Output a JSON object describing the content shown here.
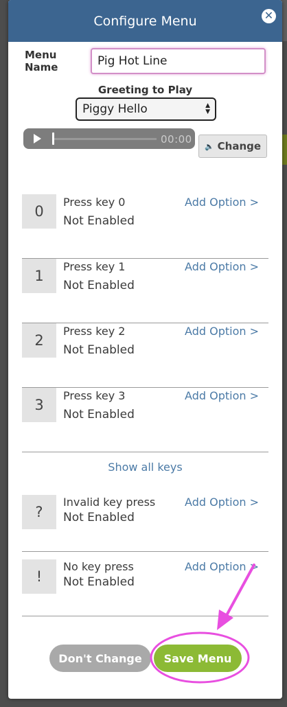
{
  "modal": {
    "title": "Configure Menu",
    "close_symbol": "✕"
  },
  "menu_name": {
    "label": "Menu Name",
    "value": "Pig Hot Line"
  },
  "greeting": {
    "label": "Greeting to Play",
    "selected": "Piggy Hello"
  },
  "audio": {
    "time": "00:00",
    "change_label": "Change"
  },
  "keys": [
    {
      "key": "0",
      "title": "Press key 0",
      "status": "Not Enabled",
      "action": "Add Option >"
    },
    {
      "key": "1",
      "title": "Press key 1",
      "status": "Not Enabled",
      "action": "Add Option >"
    },
    {
      "key": "2",
      "title": "Press key 2",
      "status": "Not Enabled",
      "action": "Add Option >"
    },
    {
      "key": "3",
      "title": "Press key 3",
      "status": "Not Enabled",
      "action": "Add Option >"
    }
  ],
  "show_all": "Show all keys",
  "special_keys": [
    {
      "key": "?",
      "title": "Invalid key press",
      "status": "Not Enabled",
      "action": "Add Option >"
    },
    {
      "key": "!",
      "title": "No key press",
      "status": "Not Enabled",
      "action": "Add Option >"
    }
  ],
  "footer": {
    "dont_change": "Don't Change",
    "save": "Save Menu"
  },
  "colors": {
    "header": "#3c6590",
    "link": "#4b7aa6",
    "save": "#8cba35",
    "cancel": "#a9a9a9",
    "annotation": "#e84fe0"
  }
}
